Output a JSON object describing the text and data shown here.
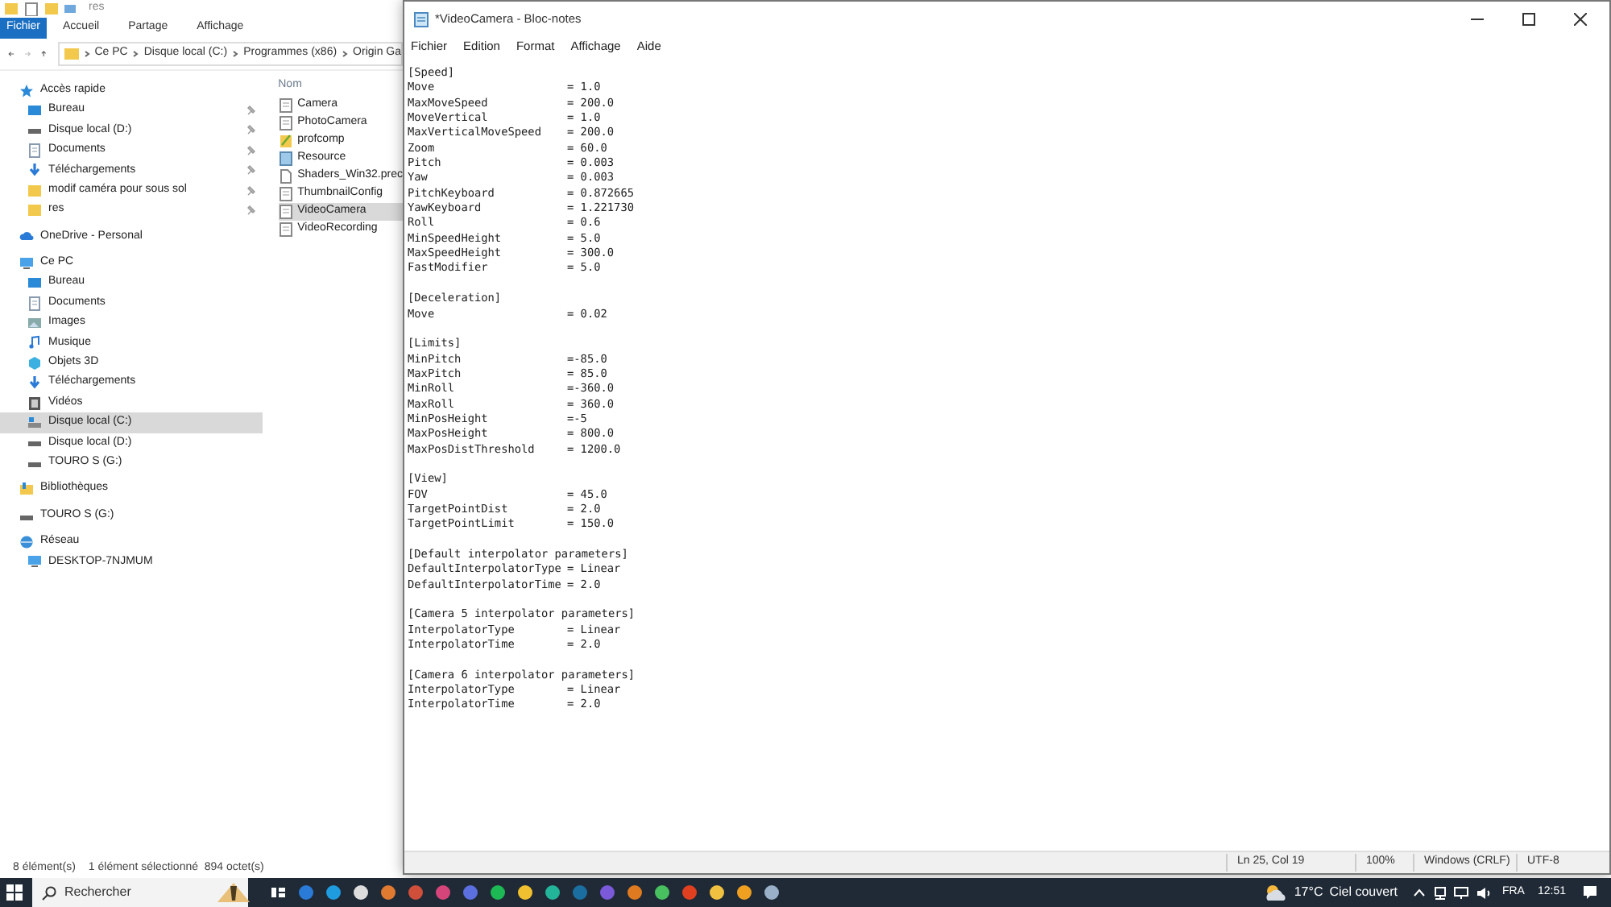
{
  "explorer": {
    "title": "res",
    "ribbon_tabs": [
      {
        "label": "Fichier",
        "selected": true
      },
      {
        "label": "Accueil",
        "selected": false
      },
      {
        "label": "Partage",
        "selected": false
      },
      {
        "label": "Affichage",
        "selected": false
      }
    ],
    "breadcrumb": [
      "Ce PC",
      "Disque local (C:)",
      "Programmes (x86)",
      "Origin Ga"
    ],
    "nav": [
      {
        "label": "Accès rapide",
        "kind": "star",
        "selected": false,
        "children": [
          {
            "label": "Bureau",
            "kind": "desktop",
            "pinned": true,
            "selected": false
          },
          {
            "label": "Disque local (D:)",
            "kind": "drive",
            "pinned": true,
            "selected": false
          },
          {
            "label": "Documents",
            "kind": "doc",
            "pinned": true,
            "selected": false
          },
          {
            "label": "Téléchargements",
            "kind": "download",
            "pinned": true,
            "selected": false
          },
          {
            "label": "modif caméra pour sous sol",
            "kind": "folder",
            "pinned": true,
            "selected": false
          },
          {
            "label": "res",
            "kind": "folder",
            "pinned": true,
            "selected": false
          }
        ]
      },
      {
        "label": "OneDrive - Personal",
        "kind": "cloud",
        "selected": false
      },
      {
        "label": "Ce PC",
        "kind": "pc",
        "selected": false,
        "children": [
          {
            "label": "Bureau",
            "kind": "desktop",
            "selected": false
          },
          {
            "label": "Documents",
            "kind": "doc",
            "selected": false
          },
          {
            "label": "Images",
            "kind": "image",
            "selected": false
          },
          {
            "label": "Musique",
            "kind": "music",
            "selected": false
          },
          {
            "label": "Objets 3D",
            "kind": "cube",
            "selected": false
          },
          {
            "label": "Téléchargements",
            "kind": "download",
            "selected": false
          },
          {
            "label": "Vidéos",
            "kind": "video",
            "selected": false
          },
          {
            "label": "Disque local (C:)",
            "kind": "windrive",
            "selected": true
          },
          {
            "label": "Disque local (D:)",
            "kind": "drive",
            "selected": false
          },
          {
            "label": "TOURO S (G:)",
            "kind": "drive",
            "selected": false
          }
        ]
      },
      {
        "label": "Bibliothèques",
        "kind": "library",
        "selected": false
      },
      {
        "label": "TOURO S (G:)",
        "kind": "drive",
        "selected": false
      },
      {
        "label": "Réseau",
        "kind": "network",
        "selected": false,
        "children": [
          {
            "label": "DESKTOP-7NJMUM",
            "kind": "pc",
            "selected": false
          }
        ]
      }
    ],
    "column_header": "Nom",
    "files": [
      {
        "name": "Camera",
        "kind": "ini",
        "selected": false
      },
      {
        "name": "PhotoCamera",
        "kind": "ini",
        "selected": false
      },
      {
        "name": "profcomp",
        "kind": "edit",
        "selected": false
      },
      {
        "name": "Resource",
        "kind": "res",
        "selected": false
      },
      {
        "name": "Shaders_Win32.prec",
        "kind": "blank",
        "selected": false
      },
      {
        "name": "ThumbnailConfig",
        "kind": "ini",
        "selected": false
      },
      {
        "name": "VideoCamera",
        "kind": "ini",
        "selected": true
      },
      {
        "name": "VideoRecording",
        "kind": "ini",
        "selected": false
      }
    ],
    "status": [
      "8 élément(s)",
      "1 élément sélectionné  894 octet(s)"
    ]
  },
  "notepad": {
    "title": "*VideoCamera - Bloc-notes",
    "menu": [
      "Fichier",
      "Edition",
      "Format",
      "Affichage",
      "Aide"
    ],
    "sections": [
      {
        "header": "[Speed]",
        "entries": [
          {
            "key": "Move",
            "value": "= 1.0"
          },
          {
            "key": "MaxMoveSpeed",
            "value": "= 200.0"
          },
          {
            "key": "MoveVertical",
            "value": "= 1.0"
          },
          {
            "key": "MaxVerticalMoveSpeed",
            "value": "= 200.0"
          },
          {
            "key": "Zoom",
            "value": "= 60.0"
          },
          {
            "key": "Pitch",
            "value": "= 0.003"
          },
          {
            "key": "Yaw",
            "value": "= 0.003"
          },
          {
            "key": "PitchKeyboard",
            "value": "= 0.872665"
          },
          {
            "key": "YawKeyboard",
            "value": "= 1.221730"
          },
          {
            "key": "Roll",
            "value": "= 0.6"
          },
          {
            "key": "MinSpeedHeight",
            "value": "= 5.0"
          },
          {
            "key": "MaxSpeedHeight",
            "value": "= 300.0"
          },
          {
            "key": "FastModifier",
            "value": "= 5.0"
          }
        ]
      },
      {
        "header": "[Deceleration]",
        "entries": [
          {
            "key": "Move",
            "value": "= 0.02"
          }
        ]
      },
      {
        "header": "[Limits]",
        "entries": [
          {
            "key": "MinPitch",
            "value": "=-85.0"
          },
          {
            "key": "MaxPitch",
            "value": "= 85.0"
          },
          {
            "key": "MinRoll",
            "value": "=-360.0"
          },
          {
            "key": "MaxRoll",
            "value": "= 360.0"
          },
          {
            "key": "MinPosHeight",
            "value": "=-5"
          },
          {
            "key": "MaxPosHeight",
            "value": "= 800.0"
          },
          {
            "key": "MaxPosDistThreshold",
            "value": "= 1200.0"
          }
        ]
      },
      {
        "header": "[View]",
        "entries": [
          {
            "key": "FOV",
            "value": "= 45.0"
          },
          {
            "key": "TargetPointDist",
            "value": "= 2.0"
          },
          {
            "key": "TargetPointLimit",
            "value": "= 150.0"
          }
        ]
      },
      {
        "header": "[Default interpolator parameters]",
        "entries": [
          {
            "key": "DefaultInterpolatorType",
            "value": "= Linear"
          },
          {
            "key": "DefaultInterpolatorTime",
            "value": "= 2.0"
          }
        ]
      },
      {
        "header": "[Camera 5 interpolator parameters]",
        "entries": [
          {
            "key": "InterpolatorType",
            "value": "= Linear"
          },
          {
            "key": "InterpolatorTime",
            "value": "= 2.0"
          }
        ]
      },
      {
        "header": "[Camera 6 interpolator parameters]",
        "entries": [
          {
            "key": "InterpolatorType",
            "value": "= Linear"
          },
          {
            "key": "InterpolatorTime",
            "value": "= 2.0"
          }
        ]
      }
    ],
    "status": [
      "Ln 25, Col 19",
      "100%",
      "Windows (CRLF)",
      "UTF-8"
    ]
  },
  "taskbar": {
    "search_placeholder": "Rechercher",
    "temperature": "17°C",
    "weather": "Ciel couvert",
    "language": "FRA",
    "time": "12:51"
  }
}
